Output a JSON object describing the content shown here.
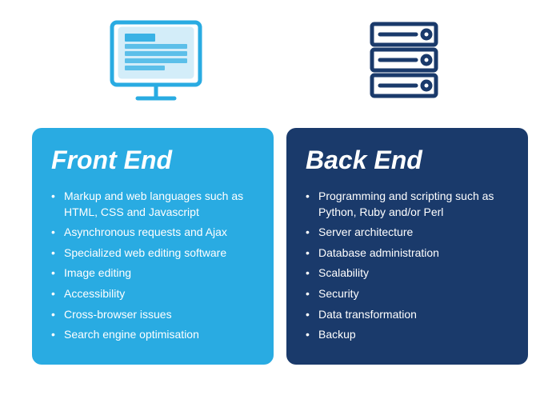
{
  "frontend": {
    "title": "Front End",
    "items": [
      "Markup and web languages such as HTML, CSS and Javascript",
      "Asynchronous requests and Ajax",
      "Specialized web editing software",
      "Image editing",
      "Accessibility",
      "Cross-browser issues",
      "Search engine optimisation"
    ]
  },
  "backend": {
    "title": "Back End",
    "items": [
      "Programming and scripting such as Python, Ruby and/or Perl",
      "Server architecture",
      "Database administration",
      "Scalability",
      "Security",
      "Data transformation",
      "Backup"
    ]
  },
  "icons": {
    "monitor": "monitor-icon",
    "server": "server-icon"
  }
}
